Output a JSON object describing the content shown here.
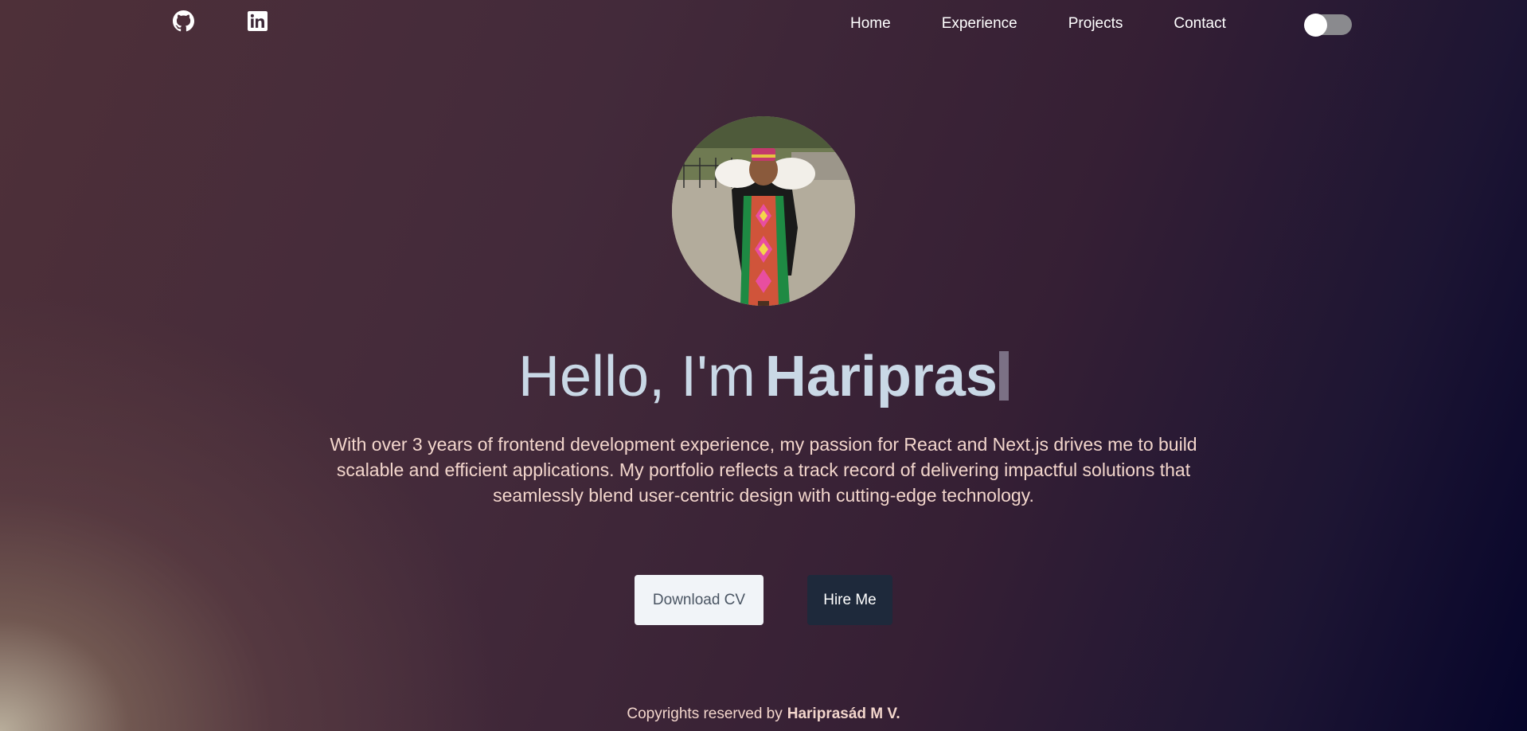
{
  "nav": {
    "social": [
      {
        "icon": "github-icon"
      },
      {
        "icon": "linkedin-icon"
      }
    ],
    "links": [
      "Home",
      "Experience",
      "Projects",
      "Contact"
    ],
    "theme_toggle": {
      "state": "off"
    }
  },
  "hero": {
    "greeting": "Hello, I'm",
    "name": "Haripras",
    "bio": "With over 3 years of frontend development experience, my passion for React and Next.js drives me to build scalable and efficient applications. My portfolio reflects a track record of delivering impactful solutions that seamlessly blend user-centric design with cutting-edge technology.",
    "download_cv_label": "Download CV",
    "hire_me_label": "Hire Me"
  },
  "footer": {
    "text": "Copyrights reserved by",
    "owner": "Hariprasád M V."
  },
  "colors": {
    "headline": "#c9d8e6",
    "bio_text": "#f3d6cc",
    "hire_button_bg": "#1e293b",
    "cv_button_bg": "#f1f4f8"
  }
}
